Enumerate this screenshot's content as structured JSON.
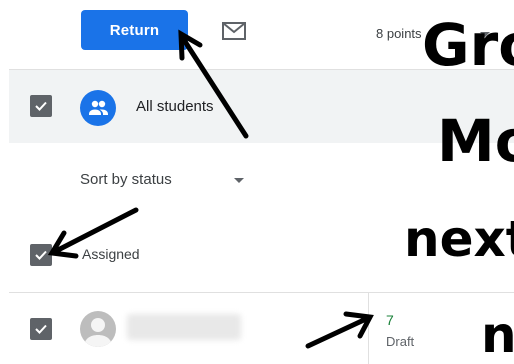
{
  "toolbar": {
    "return_label": "Return",
    "mail_icon": "mail-icon",
    "points_label": "8 points"
  },
  "roster": {
    "all_students_label": "All students",
    "sort_label": "Sort by status",
    "assigned_label": "Assigned",
    "students": [
      {
        "name": "",
        "grade": "7",
        "status": "Draft"
      }
    ]
  },
  "overlay_text": {
    "line1": "Gro",
    "line2": "Mo",
    "line3": "next",
    "line4": "n"
  },
  "colors": {
    "accent": "#1a73e8",
    "checkbox": "#5f6368",
    "grade": "#188038"
  }
}
